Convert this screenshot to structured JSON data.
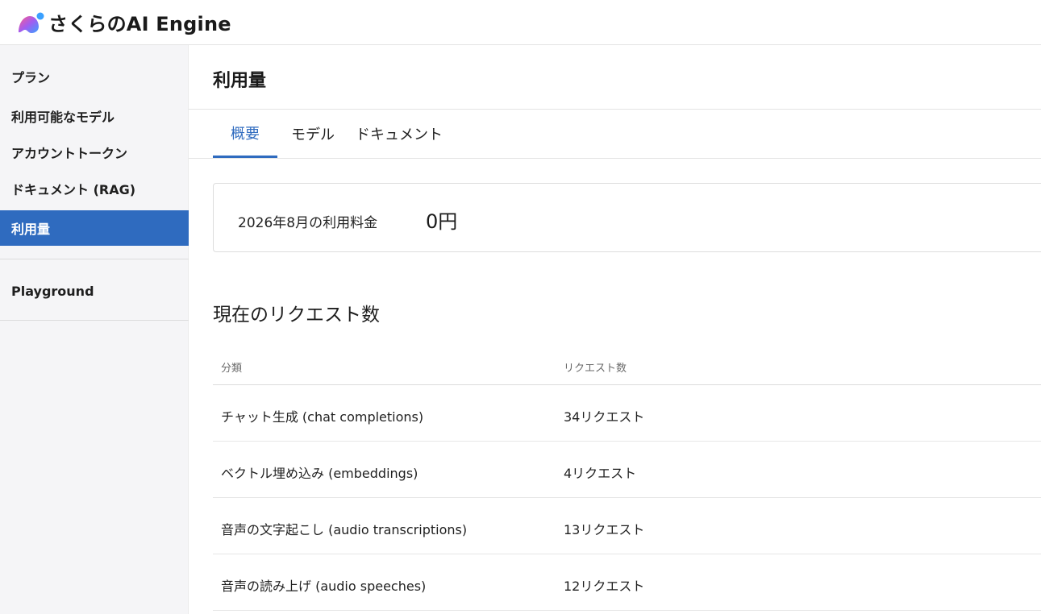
{
  "header": {
    "app_name": "さくらのAI Engine"
  },
  "sidebar": {
    "items": [
      {
        "label": "プラン"
      },
      {
        "label": "利用可能なモデル"
      },
      {
        "label": "アカウントトークン"
      },
      {
        "label": "ドキュメント (RAG)"
      },
      {
        "label": "利用量",
        "active": true
      },
      {
        "label": "Playground"
      }
    ]
  },
  "main": {
    "title": "利用量",
    "tabs": [
      {
        "label": "概要",
        "active": true
      },
      {
        "label": "モデル"
      },
      {
        "label": "ドキュメント"
      }
    ],
    "fee": {
      "label": "2026年8月の利用料金",
      "value": "0円"
    },
    "section_title": "現在のリクエスト数",
    "table": {
      "columns": [
        "分類",
        "リクエスト数"
      ],
      "rows": [
        [
          "チャット生成 (chat completions)",
          "34リクエスト"
        ],
        [
          "ベクトル埋め込み (embeddings)",
          "4リクエスト"
        ],
        [
          "音声の文字起こし (audio transcriptions)",
          "13リクエスト"
        ],
        [
          "音声の読み上げ (audio speeches)",
          "12リクエスト"
        ]
      ]
    }
  },
  "colors": {
    "accent": "#2f6bbf",
    "sidebar_bg": "#f5f5f7"
  },
  "icons": {
    "logo": "sakura-logo-icon"
  }
}
